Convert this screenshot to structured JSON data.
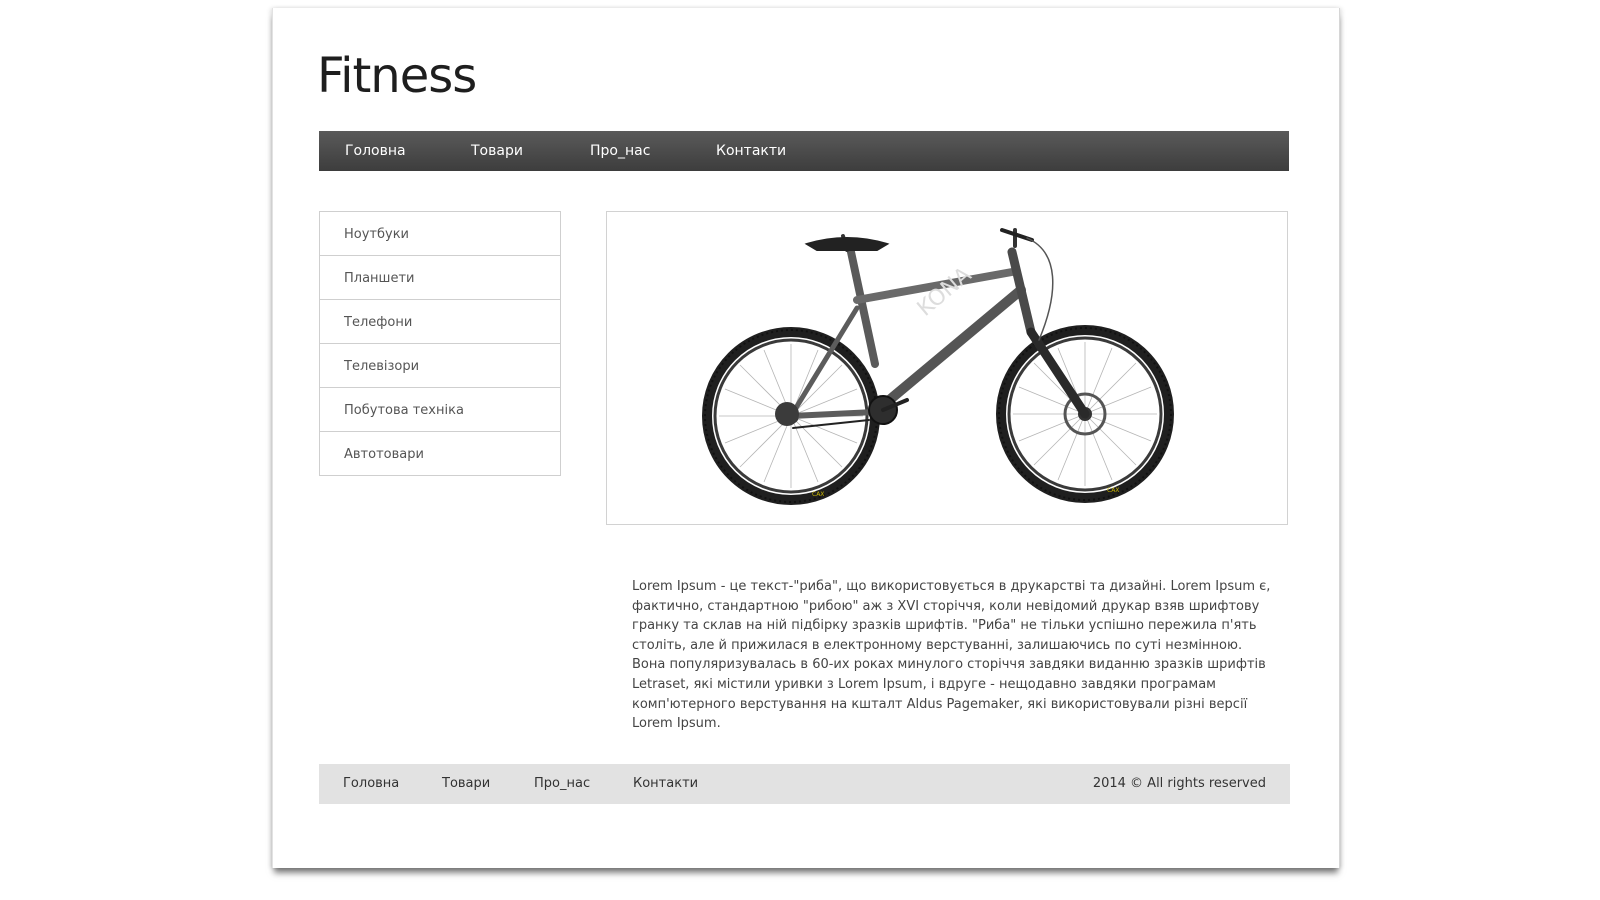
{
  "header": {
    "logo": "Fitness"
  },
  "topnav": [
    "Головна",
    "Товари",
    "Про_нас",
    "Контакти"
  ],
  "sidebar": {
    "items": [
      {
        "label": "Ноутбуки"
      },
      {
        "label": "Планшети"
      },
      {
        "label": "Телефони"
      },
      {
        "label": "Телевізори"
      },
      {
        "label": "Побутова техніка"
      },
      {
        "label": "Автотовари"
      }
    ]
  },
  "product": {
    "image": "mountain-bike-image"
  },
  "content": {
    "description": "Lorem Ipsum - це текст-\"риба\", що використовується в друкарстві та дизайні. Lorem Ipsum є, фактично, стандартною \"рибою\" аж з XVI сторіччя, коли невідомий друкар взяв шрифтову гранку та склав на ній підбірку зразків шрифтів. \"Риба\" не тільки успішно пережила п'ять століть, але й прижилася в електронному верстуванні, залишаючись по суті незмінною. Вона популяризувалась в 60-их роках минулого сторіччя завдяки виданню зразків шрифтів Letraset, які містили уривки з Lorem Ipsum, і вдруге - нещодавно завдяки програмам комп'ютерного верстування на кшталт Aldus Pagemaker, які використовували різні версії Lorem Ipsum."
  },
  "footer": {
    "links": [
      "Головна",
      "Товари",
      "Про_нас",
      "Контакти"
    ],
    "copyright": "2014 © All rights reserved"
  }
}
